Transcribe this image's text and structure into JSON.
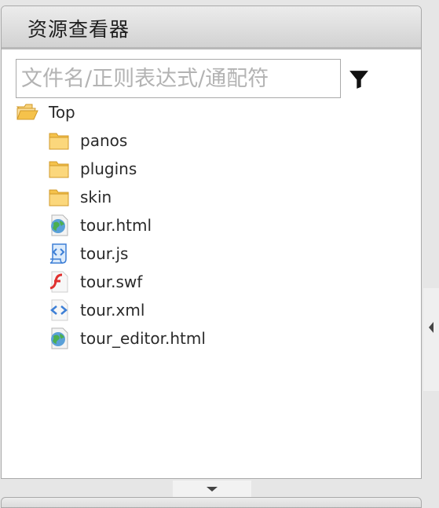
{
  "panel": {
    "title": "资源查看器"
  },
  "filter": {
    "placeholder": "文件名/正则表达式/通配符",
    "value": "",
    "icon": "funnel-icon"
  },
  "tree": {
    "root": {
      "label": "Top",
      "icon": "folder-open-icon"
    },
    "children": [
      {
        "label": "panos",
        "icon": "folder-icon",
        "type": "folder"
      },
      {
        "label": "plugins",
        "icon": "folder-icon",
        "type": "folder"
      },
      {
        "label": "skin",
        "icon": "folder-icon",
        "type": "folder"
      },
      {
        "label": "tour.html",
        "icon": "html-globe-icon",
        "type": "file"
      },
      {
        "label": "tour.js",
        "icon": "js-script-icon",
        "type": "file"
      },
      {
        "label": "tour.swf",
        "icon": "flash-swf-icon",
        "type": "file"
      },
      {
        "label": "tour.xml",
        "icon": "xml-file-icon",
        "type": "file"
      },
      {
        "label": "tour_editor.html",
        "icon": "html-globe-icon",
        "type": "file"
      }
    ]
  },
  "colors": {
    "folder": "#f5c24b",
    "html_globe": "#3b8a3f",
    "js_blue": "#3d7fd6",
    "swf_red": "#e0312f",
    "xml_blue": "#3d7fd6"
  }
}
